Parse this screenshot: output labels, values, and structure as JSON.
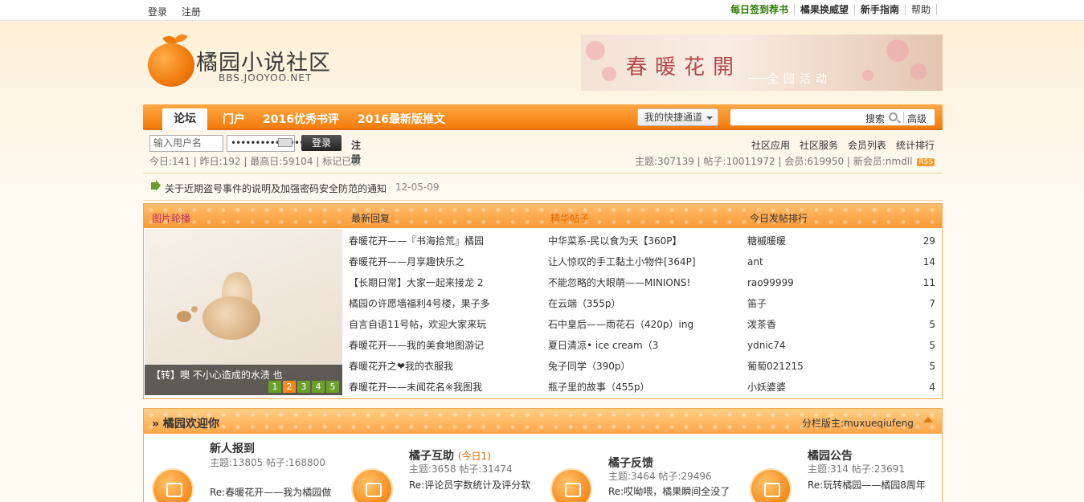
{
  "topbar": {
    "login": "登录",
    "register": "注册",
    "links": [
      "每日签到荐书",
      "橘果换威望",
      "新手指南",
      "帮助"
    ]
  },
  "header": {
    "logo_cn": "橘园小说社区",
    "logo_en": "BBS.JOOYOO.NET",
    "banner_title": "春暖花開",
    "banner_sub": "全园活动"
  },
  "nav": {
    "active": "论坛",
    "items": [
      "门户",
      "2016优秀书评",
      "2016最新版推文"
    ],
    "quick": "我的快捷通道",
    "search_btn": "搜索",
    "advanced": "高级"
  },
  "login": {
    "username_placeholder": "输入用户名",
    "password_value": "••••••••••••••••",
    "login_btn": "登录",
    "register": "注册",
    "links": [
      "社区应用",
      "社区服务",
      "会员列表",
      "统计排行"
    ]
  },
  "stats": {
    "left": "今日:141 | 昨日:192 | 最高日:59104 | 标记已读",
    "right": "主题:307139 | 帖子:10011972 | 会员:619950 | 新会员:nmdll",
    "rss": "RSS"
  },
  "notice": {
    "text": "关于近期盗号事件的说明及加强密码安全防范的通知",
    "date": "12-05-09"
  },
  "main": {
    "headers": [
      "图片轮播",
      "最新回复",
      "精华帖子",
      "今日发帖排行"
    ],
    "carousel_caption": "【转】噢 不小心造成的水渍 也",
    "carousel_dots": [
      "1",
      "2",
      "3",
      "4",
      "5"
    ],
    "hot": [
      "春暖花开——『书海拾荒』橘园",
      "春暖花开——月享趣快乐之",
      "【长期日常】大家一起来接龙 2",
      "橘园の许愿墙福利4号楼，果子多",
      "自言自语11号帖，欢迎大家来玩",
      "春暖花开——我的美食地图游记",
      "春暖花开之❤我的衣服我",
      "春暖花开——未闻花名※我图我"
    ],
    "best": [
      "中华菜系-民以食为天【360P】",
      "让人惊叹的手工黏土小物件[364P]",
      "不能忽略的大眼萌——MINIONS!",
      "在云端（355p）",
      "石中皇后——雨花石（420p）ing",
      "夏日清凉• ice cream（3",
      "兔子同学（390p）",
      "瓶子里的故事（455p）"
    ],
    "rank": [
      {
        "name": "糖槭暖暖",
        "count": "29"
      },
      {
        "name": "ant",
        "count": "14"
      },
      {
        "name": "rao99999",
        "count": "11"
      },
      {
        "name": "笛子",
        "count": "7"
      },
      {
        "name": "泼茶香",
        "count": "5"
      },
      {
        "name": "ydnic74",
        "count": "5"
      },
      {
        "name": "葡萄021215",
        "count": "5"
      },
      {
        "name": "小妖婆婆",
        "count": "4"
      }
    ]
  },
  "section": {
    "title": "» 橘园欢迎你",
    "moderator": "分栏版主:muxueqiufeng",
    "forums": [
      {
        "name": "新人报到",
        "today": "",
        "meta": "主题:13805  帖子:168800",
        "last": "Re:春暖花开——我为橘园做"
      },
      {
        "name": "橘子互助",
        "today": "(今日1)",
        "meta": "主题:3658  帖子:31474",
        "last": "Re:评论员字数统计及评分软"
      },
      {
        "name": "橘子反馈",
        "today": "",
        "meta": "主题:3464  帖子:29496",
        "last": "Re:哎呦喂，橘果瞬间全没了"
      },
      {
        "name": "橘园公告",
        "today": "",
        "meta": "主题:314  帖子:23691",
        "last": "Re:玩转橘园——橘园8周年"
      }
    ]
  }
}
